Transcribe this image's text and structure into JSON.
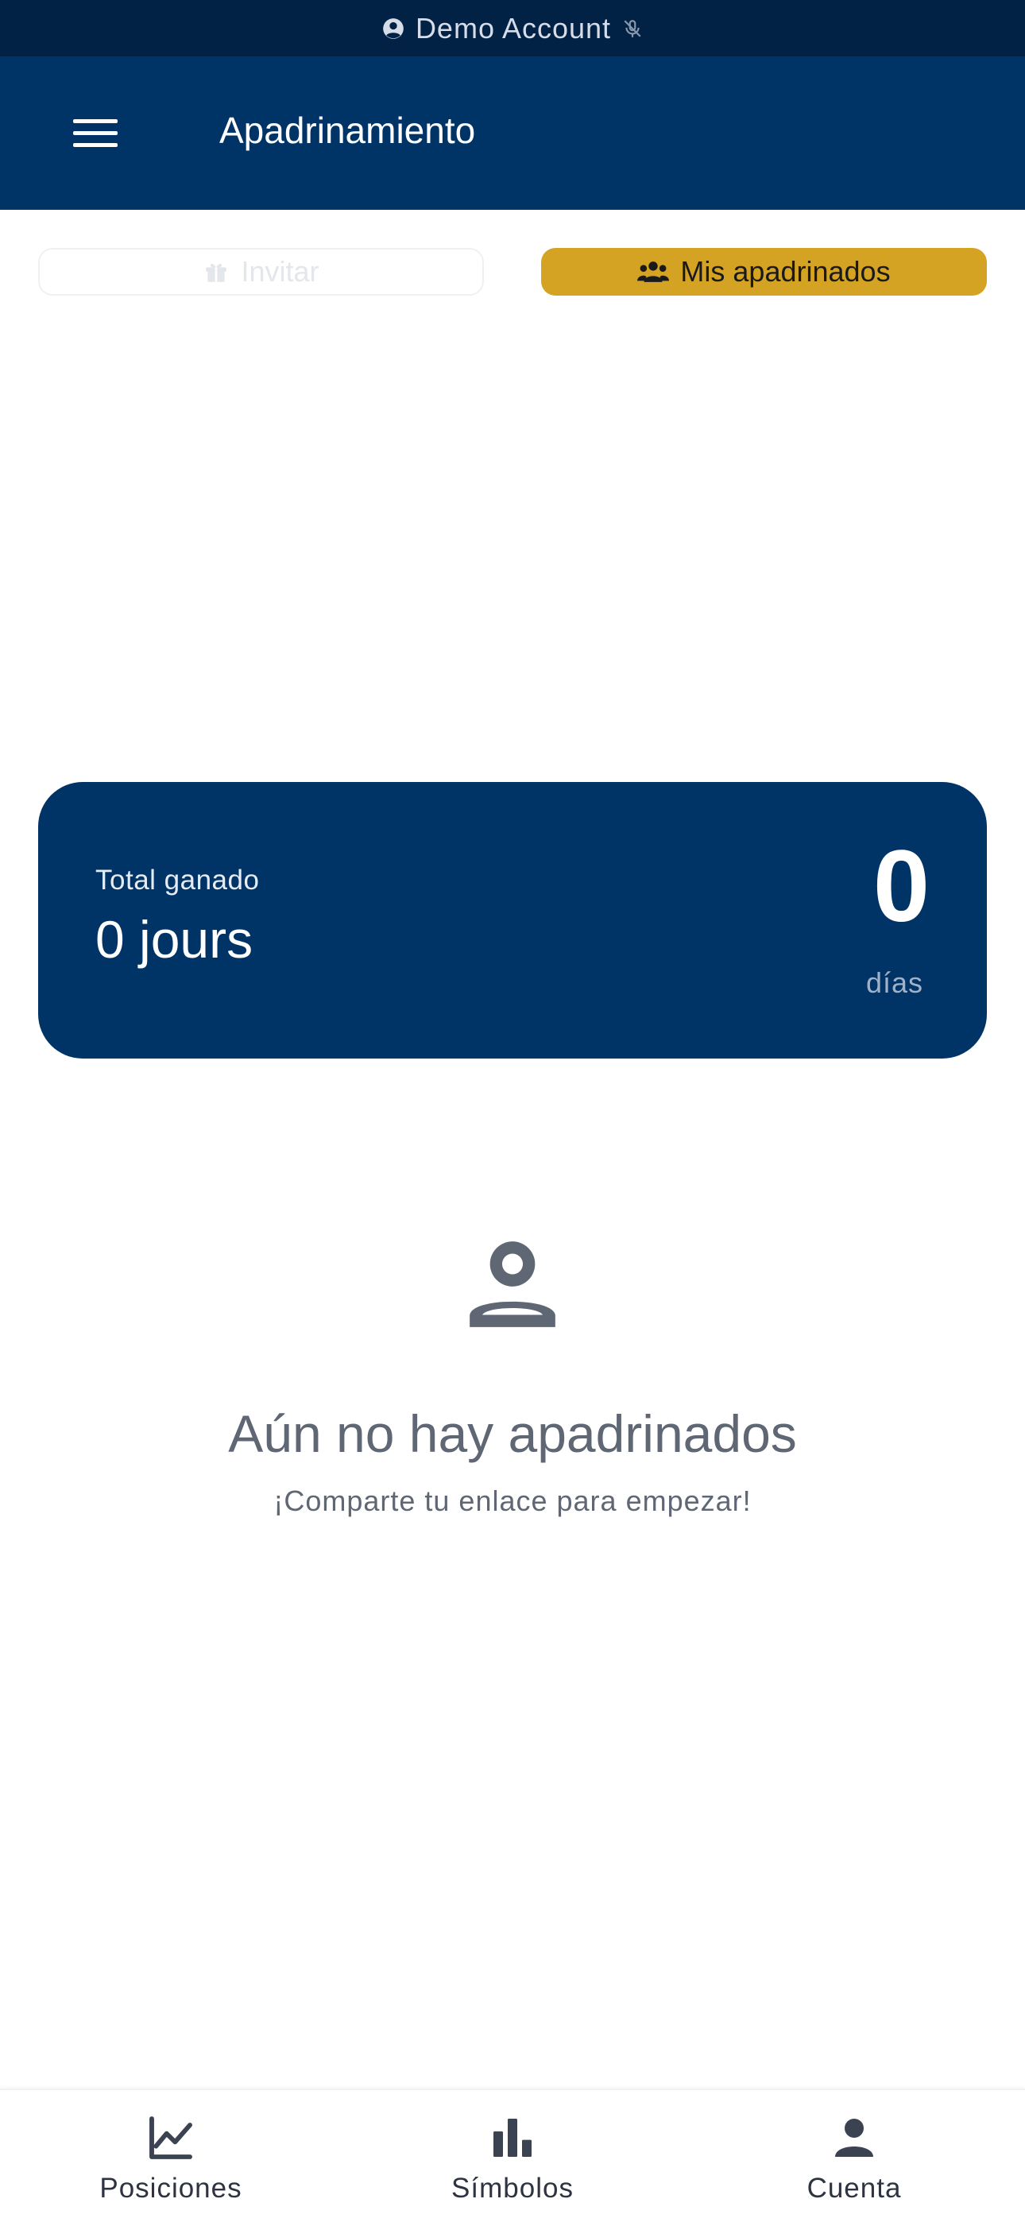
{
  "status_bar": {
    "account_label": "Demo Account",
    "account_icon": "user-circle-icon",
    "mute_icon": "mic-off-icon"
  },
  "header": {
    "title": "Apadrinamiento",
    "menu_icon": "hamburger-menu-icon"
  },
  "tabs": [
    {
      "label": "Invitar",
      "icon": "gift-icon",
      "active": false
    },
    {
      "label": "Mis apadrinados",
      "icon": "users-icon",
      "active": true
    }
  ],
  "total_card": {
    "label": "Total ganado",
    "value": "0 jours",
    "days_number": "0",
    "days_label": "días"
  },
  "empty_state": {
    "icon": "person-icon",
    "title": "Aún no hay apadrinados",
    "subtitle": "¡Comparte tu enlace para empezar!"
  },
  "bottom_nav": [
    {
      "label": "Posiciones",
      "icon": "line-chart-icon"
    },
    {
      "label": "Símbolos",
      "icon": "bar-chart-icon"
    },
    {
      "label": "Cuenta",
      "icon": "person-icon"
    }
  ],
  "colors": {
    "brand_navy": "#003366",
    "status_bar": "#012145",
    "accent_gold": "#d4a324"
  }
}
